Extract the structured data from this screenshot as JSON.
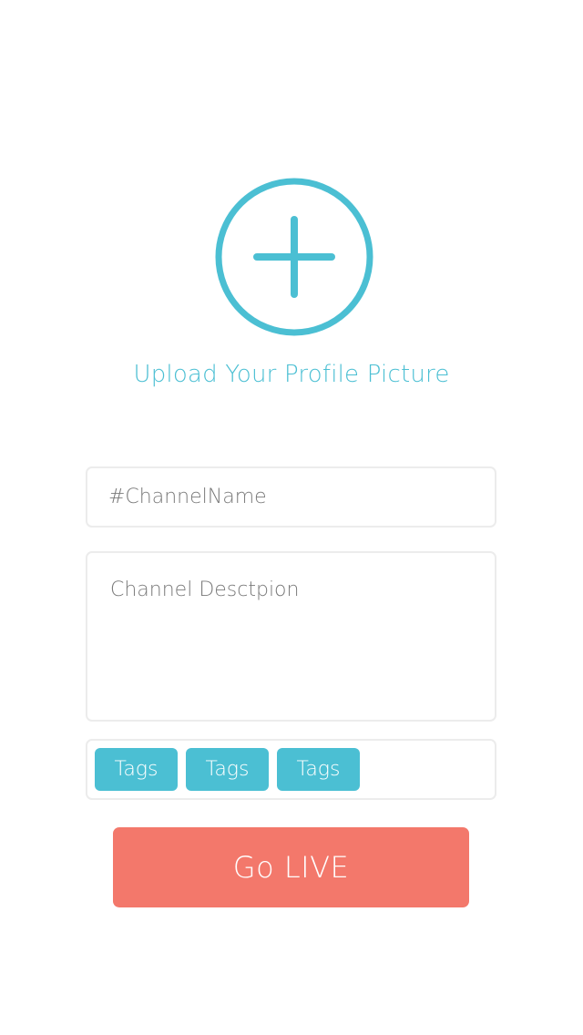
{
  "colors": {
    "accent": "#4bbfd3",
    "primary_button": "#f3786b",
    "field_border": "#ececec",
    "placeholder_text": "#7a7a7a",
    "background": "#ffffff"
  },
  "upload": {
    "icon": "plus-icon",
    "label": "Upload Your Profile Picture"
  },
  "form": {
    "channel_name_placeholder": "#ChannelName",
    "channel_description_placeholder": "Channel Desctpion",
    "tags": [
      "Tags",
      "Tags",
      "Tags"
    ]
  },
  "actions": {
    "go_live_label": "Go LIVE"
  }
}
